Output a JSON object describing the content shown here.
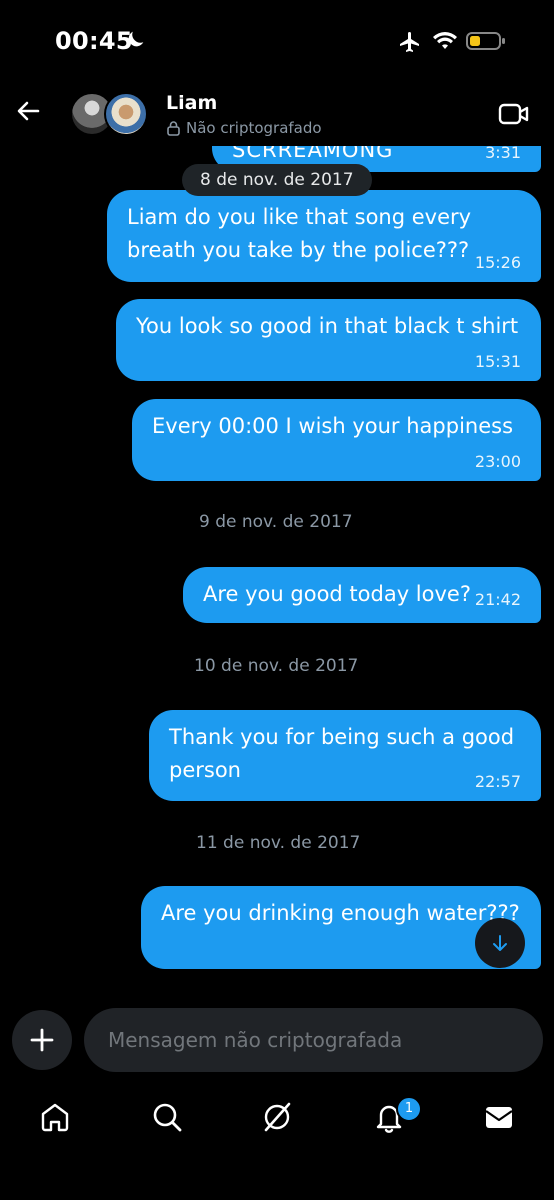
{
  "status_bar": {
    "time": "00:45",
    "battery_color": "#f5c518"
  },
  "header": {
    "name": "Liam",
    "encryption_label": "Não criptografado"
  },
  "messages": [
    {
      "text": "SCRREAMONG",
      "time": "3:31"
    },
    {
      "date": "8 de nov. de 2017"
    },
    {
      "text": "Liam do you like that song every breath you take by the police???",
      "time": "15:26"
    },
    {
      "text": "You look so good in that black t shirt",
      "time": "15:31"
    },
    {
      "text": "Every 00:00 I wish your happiness",
      "time": "23:00"
    },
    {
      "date": "9 de nov. de 2017"
    },
    {
      "text": "Are you good today love?",
      "time": "21:42"
    },
    {
      "date": "10 de nov. de 2017"
    },
    {
      "text": "Thank you for being such a good person",
      "time": "22:57"
    },
    {
      "date": "11 de nov. de 2017"
    },
    {
      "text": "Are you drinking enough water???",
      "time": ""
    }
  ],
  "composer": {
    "placeholder": "Mensagem não criptografada"
  },
  "nav": {
    "items": [
      "home-icon",
      "search-icon",
      "grok-icon",
      "notifications-icon",
      "messages-icon"
    ],
    "notification_count": "1"
  },
  "colors": {
    "accent": "#1d9bf0",
    "background": "#000000",
    "muted": "#8b98a5"
  }
}
